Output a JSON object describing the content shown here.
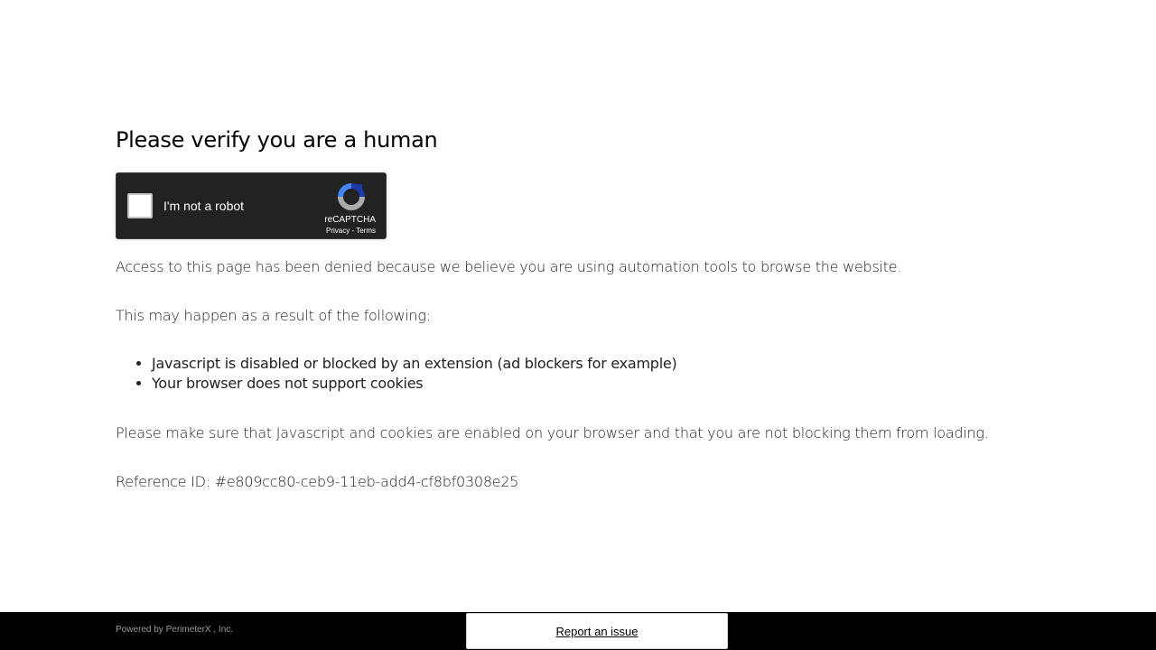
{
  "heading": "Please verify you are a human",
  "captcha": {
    "label": "I'm not a robot",
    "brand": "reCAPTCHA",
    "privacy": "Privacy",
    "separator": " - ",
    "terms": "Terms",
    "logo_colors": [
      "#1c3aa9",
      "#4285f4",
      "#ababab"
    ]
  },
  "messages": {
    "denied": "Access to this page has been denied because we believe you are using automation tools to browse the website.",
    "may_happen": "This may happen as a result of the following:",
    "reasons": [
      "Javascript is disabled or blocked by an extension (ad blockers for example)",
      "Your browser does not support cookies"
    ],
    "make_sure": "Please make sure that Javascript and cookies are enabled on your browser and that you are not blocking them from loading.",
    "reference": "Reference ID: #e809cc80-ceb9-11eb-add4-cf8bf0308e25"
  },
  "footer": {
    "powered_by": "Powered by PerimeterX , Inc.",
    "report_label": "Report an issue"
  }
}
